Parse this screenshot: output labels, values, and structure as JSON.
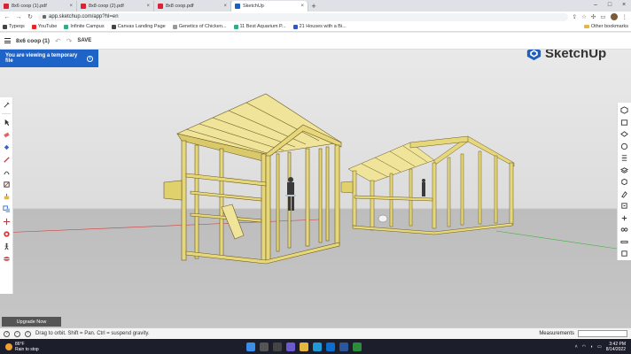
{
  "browser": {
    "tabs": [
      {
        "title": "8x6 coop (1).pdf",
        "icon": "pdf-icon"
      },
      {
        "title": "8x8 coop (2).pdf",
        "icon": "pdf-icon"
      },
      {
        "title": "8x8 coop.pdf",
        "icon": "pdf-icon"
      },
      {
        "title": "SketchUp",
        "icon": "sketchup-icon",
        "active": true
      }
    ],
    "url": "app.sketchup.com/app?hl=en",
    "bookmarks": [
      "Typeqs",
      "YouTube",
      "Infinite Campus",
      "Canvas Landing Page",
      "Genetics of Chicken...",
      "11 Best Aquarium P...",
      "21 Houses with a Bi..."
    ],
    "other_bookmarks": "Other bookmarks"
  },
  "sketchup": {
    "file_title": "8x6 coop (1)",
    "save_label": "SAVE",
    "notice": "You are viewing a temporary file",
    "brand": "SketchUp",
    "upgrade_label": "Upgrade Now",
    "status_hint": "Drag to orbit. Shift = Pan. Ctrl = suspend gravity.",
    "measurements_label": "Measurements",
    "left_tools": [
      "select-icon",
      "eraser-icon",
      "paint-bucket-icon",
      "pencil-icon",
      "line-icon",
      "rectangle-icon",
      "push-pull-icon",
      "copy-icon",
      "move-icon",
      "rotate-icon",
      "orbit-icon",
      "walk-icon",
      "section-icon"
    ],
    "right_tools": [
      "entity-info-icon",
      "components-icon",
      "styles-icon",
      "materials-icon",
      "outliner-icon",
      "layers-icon",
      "scenes-icon",
      "tags-icon",
      "instructor-icon",
      "display-icon",
      "glasses-icon",
      "ruler-icon",
      "zoom-icon"
    ]
  },
  "taskbar": {
    "temperature": "86°F",
    "weather": "Rain to stop",
    "time": "3:42 PM",
    "date": "8/14/2022"
  },
  "colors": {
    "accent": "#1e64c8",
    "lumber": "#e6d77a",
    "axis_red": "#d23b3b",
    "axis_green": "#3bb33b"
  }
}
